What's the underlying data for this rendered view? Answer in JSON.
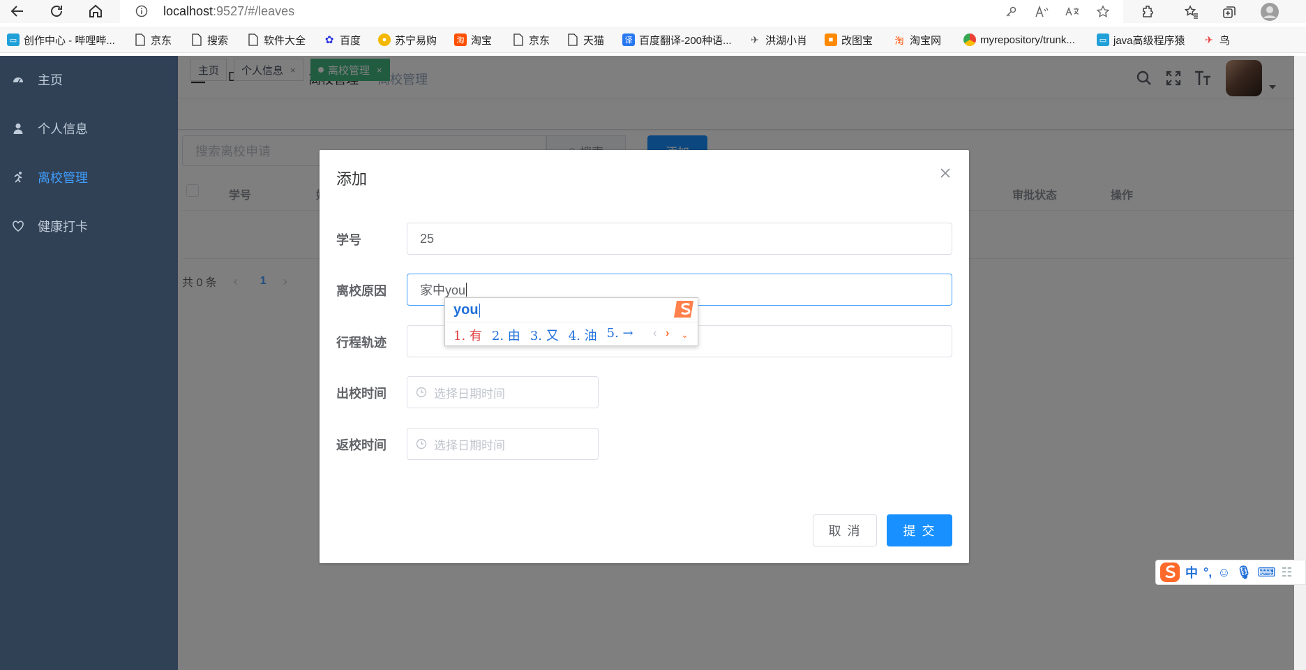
{
  "browser": {
    "url_host": "localhost",
    "url_path": ":9527/#/leaves",
    "bookmarks": [
      {
        "label": "创作中心 - 哔哩哔...",
        "icon": "bilibili-icon"
      },
      {
        "label": "京东",
        "icon": "page-icon"
      },
      {
        "label": "搜索",
        "icon": "page-icon"
      },
      {
        "label": "软件大全",
        "icon": "page-icon"
      },
      {
        "label": "百度",
        "icon": "baidu-icon"
      },
      {
        "label": "苏宁易购",
        "icon": "suning-icon"
      },
      {
        "label": "淘宝",
        "icon": "taobao-icon"
      },
      {
        "label": "京东",
        "icon": "page-icon"
      },
      {
        "label": "天猫",
        "icon": "page-icon"
      },
      {
        "label": "百度翻译-200种语...",
        "icon": "translate-icon"
      },
      {
        "label": "洪湖小肖",
        "icon": "bird-icon"
      },
      {
        "label": "改图宝",
        "icon": "folder-icon"
      },
      {
        "label": "淘宝网",
        "icon": "taobao-icon"
      },
      {
        "label": "myrepository/trunk...",
        "icon": "chrome-icon"
      },
      {
        "label": "java高级程序猿",
        "icon": "bilibili-icon"
      },
      {
        "label": "鸟",
        "icon": "bird-icon"
      }
    ]
  },
  "sidebar": {
    "items": [
      {
        "label": "主页",
        "icon": "dashboard-icon"
      },
      {
        "label": "个人信息",
        "icon": "user-icon"
      },
      {
        "label": "离校管理",
        "icon": "run-icon",
        "active": true
      },
      {
        "label": "健康打卡",
        "icon": "heart-icon"
      }
    ]
  },
  "navbar": {
    "breadcrumb": [
      "Dashboard",
      "离校管理",
      "离校管理"
    ]
  },
  "tags": [
    {
      "label": "主页",
      "closable": false
    },
    {
      "label": "个人信息",
      "closable": true
    },
    {
      "label": "离校管理",
      "closable": true,
      "active": true
    }
  ],
  "toolbar": {
    "search_placeholder": "搜索离校申请",
    "search_label": "搜索",
    "add_label": "添加"
  },
  "table": {
    "headers": [
      "学号",
      "姓",
      "审批状态",
      "操作"
    ],
    "rows": []
  },
  "pagination": {
    "total_text": "共 0 条",
    "current_page": "1"
  },
  "dialog": {
    "title": "添加",
    "fields": {
      "student_id": {
        "label": "学号",
        "value": "25"
      },
      "reason": {
        "label": "离校原因",
        "value": "家中you"
      },
      "route": {
        "label": "行程轨迹",
        "value": ""
      },
      "leave_time": {
        "label": "出校时间",
        "placeholder": "选择日期时间"
      },
      "return_time": {
        "label": "返校时间",
        "placeholder": "选择日期时间"
      }
    },
    "cancel_label": "取 消",
    "submit_label": "提 交"
  },
  "ime": {
    "composition": "you",
    "candidates": [
      "1. 有",
      "2. 由",
      "3. 又",
      "4. 油",
      "5. →"
    ],
    "status_lang": "中",
    "status_punct": "°,"
  },
  "colors": {
    "sidebar_bg": "#304156",
    "sidebar_active": "#409eff",
    "primary": "#1890ff",
    "tag_active": "#42b983"
  }
}
